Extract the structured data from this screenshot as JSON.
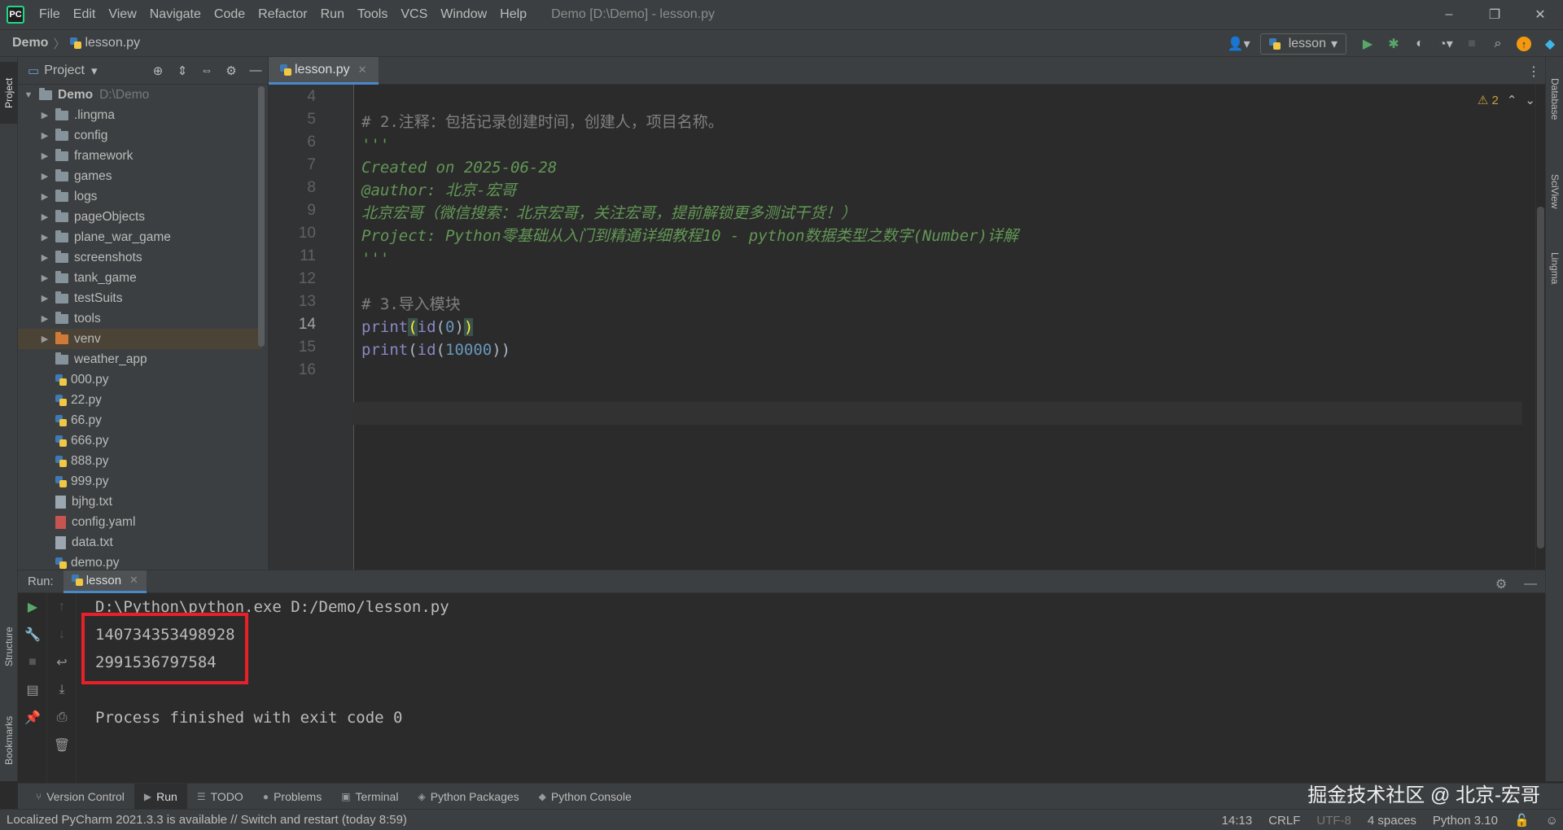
{
  "window": {
    "title": "Demo [D:\\Demo] - lesson.py",
    "minimize": "–",
    "maximize": "❐",
    "close": "✕"
  },
  "menu": [
    "File",
    "Edit",
    "View",
    "Navigate",
    "Code",
    "Refactor",
    "Run",
    "Tools",
    "VCS",
    "Window",
    "Help"
  ],
  "nav": {
    "project": "Demo",
    "file": "lesson.py",
    "run_config": "lesson"
  },
  "side_tabs": {
    "project": "Project",
    "structure": "Structure",
    "bookmarks": "Bookmarks",
    "database": "Database",
    "sciview": "SciView",
    "lingma": "Lingma"
  },
  "project_panel": {
    "title": "Project",
    "tree": [
      {
        "label": "Demo",
        "note": "D:\\Demo",
        "type": "root"
      },
      {
        "label": ".lingma",
        "type": "folder"
      },
      {
        "label": "config",
        "type": "folder"
      },
      {
        "label": "framework",
        "type": "folder"
      },
      {
        "label": "games",
        "type": "folder"
      },
      {
        "label": "logs",
        "type": "folder"
      },
      {
        "label": "pageObjects",
        "type": "folder"
      },
      {
        "label": "plane_war_game",
        "type": "folder"
      },
      {
        "label": "screenshots",
        "type": "folder"
      },
      {
        "label": "tank_game",
        "type": "folder"
      },
      {
        "label": "testSuits",
        "type": "folder"
      },
      {
        "label": "tools",
        "type": "folder"
      },
      {
        "label": "venv",
        "type": "folder-orange"
      },
      {
        "label": "weather_app",
        "type": "folder-noarrow"
      },
      {
        "label": "000.py",
        "type": "py"
      },
      {
        "label": "22.py",
        "type": "py"
      },
      {
        "label": "66.py",
        "type": "py"
      },
      {
        "label": "666.py",
        "type": "py"
      },
      {
        "label": "888.py",
        "type": "py"
      },
      {
        "label": "999.py",
        "type": "py"
      },
      {
        "label": "bjhg.txt",
        "type": "txt"
      },
      {
        "label": "config.yaml",
        "type": "yaml"
      },
      {
        "label": "data.txt",
        "type": "txt"
      },
      {
        "label": "demo.py",
        "type": "py"
      }
    ]
  },
  "editor": {
    "tab": "lesson.py",
    "warnings": "⚠ 2",
    "current_line": 14,
    "lines": [
      {
        "n": "4",
        "text": ""
      },
      {
        "n": "5",
        "text": "# 2.注释：包括记录创建时间，创建人，项目名称。"
      },
      {
        "n": "6",
        "text": "'''"
      },
      {
        "n": "7",
        "text": "Created on 2025-06-28"
      },
      {
        "n": "8",
        "text": "@author: 北京-宏哥"
      },
      {
        "n": "9",
        "text": "北京宏哥（微信搜索：北京宏哥，关注宏哥，提前解锁更多测试干货！）"
      },
      {
        "n": "10",
        "text": "Project: Python零基础从入门到精通详细教程10 - python数据类型之数字(Number)详解"
      },
      {
        "n": "11",
        "text": "'''"
      },
      {
        "n": "12",
        "text": ""
      },
      {
        "n": "13",
        "text": "# 3.导入模块"
      },
      {
        "n": "14",
        "text": "print(id(0))"
      },
      {
        "n": "15",
        "text": "print(id(10000))"
      },
      {
        "n": "16",
        "text": ""
      }
    ],
    "code14": {
      "fn": "print",
      "open1": "(",
      "inner": "id",
      "open2": "(",
      "num": "0",
      "close2": ")",
      "close1": ")"
    },
    "code15": {
      "fn": "print",
      "open1": "(",
      "inner": "id",
      "open2": "(",
      "num": "10000",
      "close": "))"
    }
  },
  "run": {
    "label": "Run:",
    "tab": "lesson",
    "console": [
      "D:\\Python\\python.exe D:/Demo/lesson.py",
      "140734353498928",
      "2991536797584",
      "",
      "Process finished with exit code 0"
    ]
  },
  "toolwindows": [
    {
      "label": "Version Control",
      "icon": "⑂"
    },
    {
      "label": "Run",
      "icon": "▶"
    },
    {
      "label": "TODO",
      "icon": "☰"
    },
    {
      "label": "Problems",
      "icon": "●"
    },
    {
      "label": "Terminal",
      "icon": "▣"
    },
    {
      "label": "Python Packages",
      "icon": "◈"
    },
    {
      "label": "Python Console",
      "icon": "◆"
    }
  ],
  "watermark": "掘金技术社区 @ 北京-宏哥",
  "status": {
    "message": "Localized PyCharm 2021.3.3 is available // Switch and restart (today 8:59)",
    "position": "14:13",
    "line_sep": "CRLF",
    "encoding": "UTF-8",
    "indent": "4 spaces",
    "interpreter": "Python 3.10"
  }
}
